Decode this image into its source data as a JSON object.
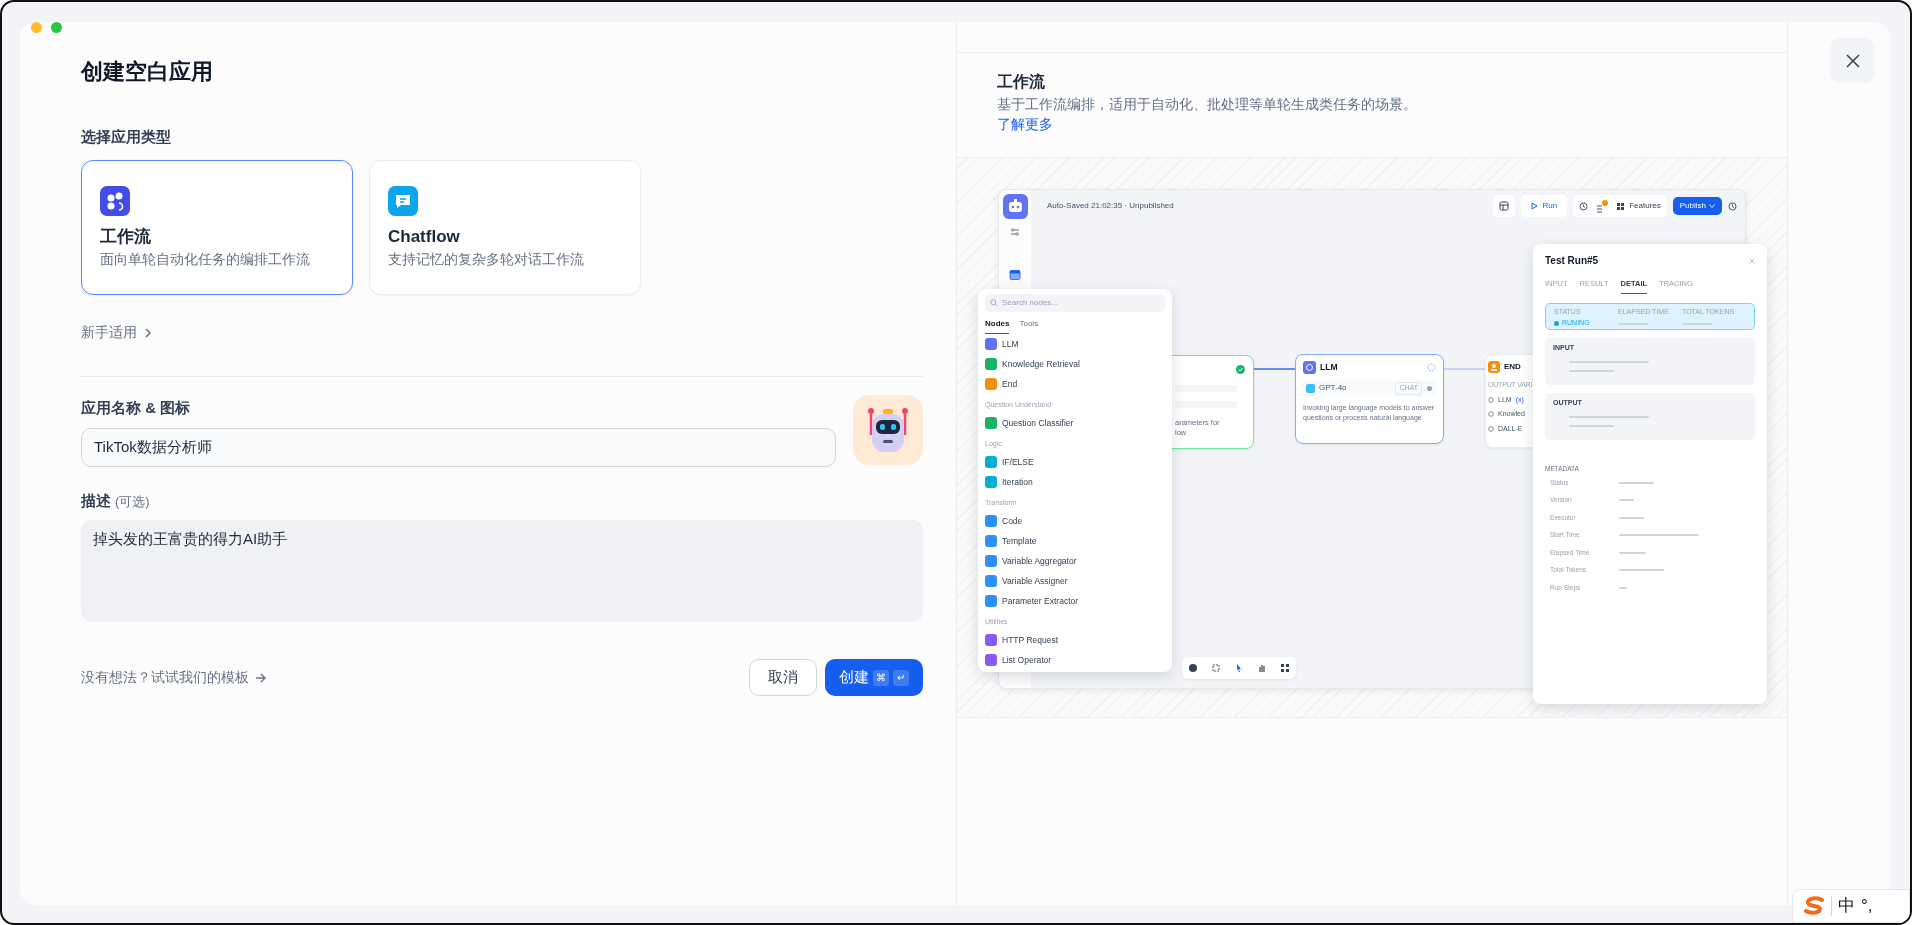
{
  "dialog": {
    "title": "创建空白应用",
    "type_label": "选择应用类型",
    "app_types": [
      {
        "kind": "workflow",
        "name": "工作流",
        "description": "面向单轮自动化任务的编排工作流",
        "selected": true
      },
      {
        "kind": "chat",
        "name": "Chatflow",
        "description": "支持记忆的复杂多轮对话工作流",
        "selected": false
      }
    ],
    "beginner_link": "新手适用",
    "name_label": "应用名称 & 图标",
    "name_value": "TikTok数据分析师",
    "description_label": "描述",
    "description_optional": "(可选)",
    "description_value": "掉头发的王富贵的得力AI助手",
    "template_link": "没有想法？试试我们的模板",
    "buttons": [
      {
        "kind": "secondary",
        "label": "取消"
      },
      {
        "kind": "primary",
        "label": "创建",
        "shortcut": [
          "⌘",
          "↵"
        ]
      }
    ]
  },
  "preview": {
    "title": "工作流",
    "description": "基于工作流编排，适用于自动化、批处理等单轮生成类任务的场景。",
    "link": "了解更多",
    "editor": {
      "status": "Auto-Saved 21:02:35 · Unpublished",
      "run": "Run",
      "features": "Features",
      "publish": "Publish",
      "search_placeholder": "Search nodes...",
      "tabs": [
        {
          "label": "Nodes",
          "selected": true
        },
        {
          "label": "Tools",
          "selected": false
        }
      ],
      "node_groups": [
        {
          "items": [
            {
              "label": "LLM",
              "color": "#6172f3"
            },
            {
              "label": "Knowledge Retrieval",
              "color": "#16b364"
            },
            {
              "label": "End",
              "color": "#f79009"
            }
          ]
        },
        {
          "heading": "Question Understand",
          "items": [
            {
              "label": "Question Classifier",
              "color": "#16b364"
            }
          ]
        },
        {
          "heading": "Logic",
          "items": [
            {
              "label": "IF/ELSE",
              "color": "#06aed4"
            },
            {
              "label": "Iteration",
              "color": "#06aed4"
            }
          ]
        },
        {
          "heading": "Transform",
          "items": [
            {
              "label": "Code",
              "color": "#2e90fa"
            },
            {
              "label": "Template",
              "color": "#2e90fa"
            },
            {
              "label": "Variable Aggregator",
              "color": "#2e90fa"
            },
            {
              "label": "Variable Assigner",
              "color": "#2e90fa"
            },
            {
              "label": "Parameter Extractor",
              "color": "#2e90fa"
            }
          ]
        },
        {
          "heading": "Utilities",
          "items": [
            {
              "label": "HTTP Request",
              "color": "#875bf7"
            },
            {
              "label": "List Operator",
              "color": "#875bf7"
            }
          ]
        }
      ],
      "start_node": {
        "lines": [
          "arameters for",
          "low"
        ]
      },
      "llm_node": {
        "title": "LLM",
        "model": "GPT-4o",
        "mode": "CHAT",
        "description": "Invoking large language models to answer questions or process natural language"
      },
      "end_node": {
        "title": "END",
        "output_label": "OUTPUT VARI",
        "vars": [
          "LLM",
          "Knowled",
          "DALL-E"
        ],
        "var_tag": "(x)"
      },
      "test_run": {
        "title": "Test Run#5",
        "tabs": [
          {
            "label": "INPUT",
            "selected": false
          },
          {
            "label": "RESULT",
            "selected": false
          },
          {
            "label": "DETAIL",
            "selected": true
          },
          {
            "label": "TRACING",
            "selected": false
          }
        ],
        "stats": [
          {
            "label": "STATUS",
            "value": "RUNING"
          },
          {
            "label": "ELAPSED TIME"
          },
          {
            "label": "TOTAL TOKENS"
          }
        ],
        "sections": [
          "INPUT",
          "OUTPUT"
        ],
        "metadata_title": "METADATA",
        "metadata": [
          "Status",
          "Version",
          "Executor",
          "Start Time",
          "Elapsed Time",
          "Total Tokens",
          "Run Steps"
        ]
      }
    }
  },
  "ime": {
    "mode": "中",
    "punctuation": "°,"
  }
}
